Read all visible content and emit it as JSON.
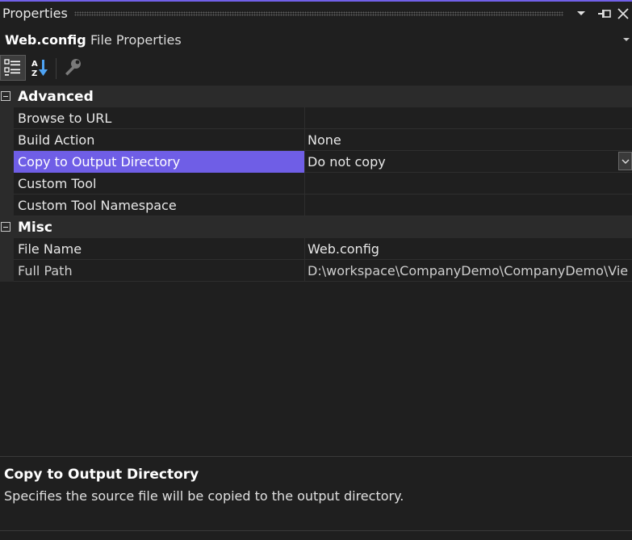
{
  "window": {
    "title": "Properties",
    "accent_color": "#7160e8"
  },
  "title_buttons": [
    {
      "icon": "chevron-down-icon",
      "tooltip": "Window Position"
    },
    {
      "icon": "pin-icon",
      "tooltip": "Auto Hide"
    },
    {
      "icon": "close-icon",
      "tooltip": "Close"
    }
  ],
  "object_selector": {
    "name": "Web.config",
    "kind": "File Properties"
  },
  "toolbar": {
    "buttons": [
      {
        "icon": "categorized-icon",
        "active": true
      },
      {
        "icon": "alphabetical-icon",
        "active": false
      },
      {
        "icon": "property-pages-icon",
        "active": false
      }
    ]
  },
  "categories": [
    {
      "label": "Advanced",
      "expanded": true,
      "rows": [
        {
          "name": "Browse to URL",
          "value": ""
        },
        {
          "name": "Build Action",
          "value": "None"
        },
        {
          "name": "Copy to Output Directory",
          "value": "Do not copy",
          "selected": true,
          "has_dropdown": true
        },
        {
          "name": "Custom Tool",
          "value": ""
        },
        {
          "name": "Custom Tool Namespace",
          "value": ""
        }
      ]
    },
    {
      "label": "Misc",
      "expanded": true,
      "rows": [
        {
          "name": "File Name",
          "value": "Web.config"
        },
        {
          "name": "Full Path",
          "value": "D:\\workspace\\CompanyDemo\\CompanyDemo\\Vie",
          "readonly": true
        }
      ]
    }
  ],
  "description": {
    "title": "Copy to Output Directory",
    "text": "Specifies the source file will be copied to the output directory."
  },
  "colors": {
    "background": "#1f1f1f",
    "category_background": "#2b2b2b",
    "selection": "#6f5ee6"
  }
}
